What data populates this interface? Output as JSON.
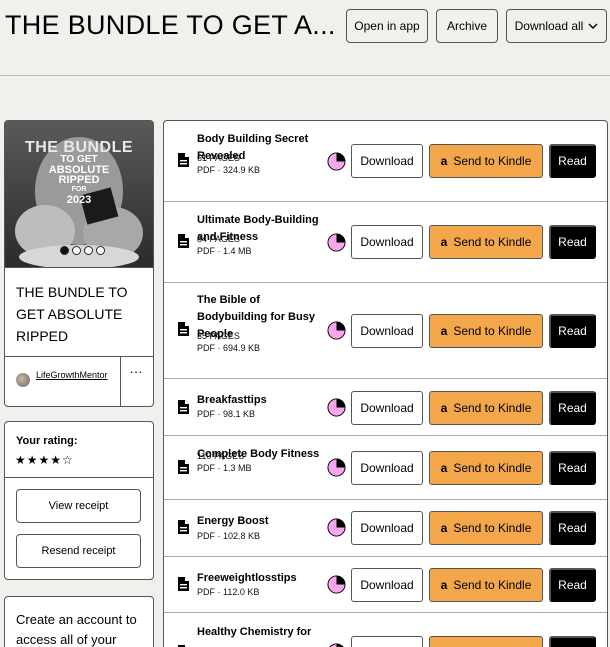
{
  "header": {
    "title": "THE BUNDLE TO GET A...",
    "open_in_app": "Open in app",
    "archive": "Archive",
    "download_all": "Download all"
  },
  "sidebar": {
    "cover": {
      "line1": "THE BUNDLE",
      "line2": "TO GET",
      "line3": "ABSOLUTE",
      "line4": "RIPPED",
      "line5": "FOR",
      "line6": "2023"
    },
    "product_title": "THE BUNDLE TO GET ABSOLUTE RIPPED",
    "creator": "LifeGrowthMentor",
    "more": "···",
    "rating_label": "Your rating:",
    "rating_stars": "★★★★☆",
    "rating_value": 4,
    "view_receipt": "View receipt",
    "resend_receipt": "Resend receipt",
    "account_text": "Create an account to access all of your"
  },
  "items": [
    {
      "title": "Body Building Secret Revealed",
      "pages": "61 PAGES",
      "meta": "PDF · 324.9 KB"
    },
    {
      "title": "Ultimate Body-Building and Fitness",
      "pages": "84 PAGES",
      "meta": "PDF · 1.4 MB"
    },
    {
      "title": "The Bible of Bodybuilding for Busy People",
      "pages": "35 PAGES",
      "meta": "PDF · 694.9 KB"
    },
    {
      "title": "Breakfasttips",
      "pages": "",
      "meta": "PDF · 98.1 KB"
    },
    {
      "title": "Complete Body Fitness",
      "pages": "110 PAGES",
      "meta": "PDF · 1.3 MB"
    },
    {
      "title": "Energy Boost",
      "pages": "",
      "meta": "PDF · 102.8 KB"
    },
    {
      "title": "Freeweightlosstips",
      "pages": "",
      "meta": "PDF · 112.0 KB"
    },
    {
      "title": "Healthy Chemistry for",
      "pages": "",
      "meta": ""
    }
  ],
  "buttons": {
    "download": "Download",
    "send_to_kindle": "Send to Kindle",
    "read": "Read",
    "amazon_glyph": "a"
  },
  "colors": {
    "background": "#f2f0ed",
    "kindle": "#f3a74a",
    "pie": "#f9a6ee",
    "read": "#000000"
  }
}
